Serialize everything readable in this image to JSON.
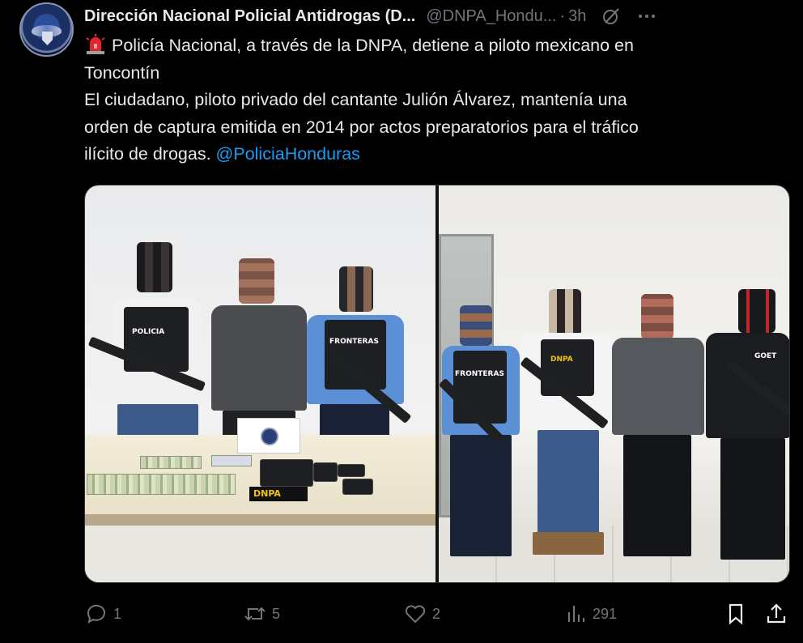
{
  "post": {
    "author_name": "Dirección Nacional Policial Antidrogas (D...",
    "handle": "@DNPA_Hondu...",
    "separator": "·",
    "time": "3h",
    "text": {
      "line1": "Policía Nacional, a través de la DNPA, detiene a piloto mexicano en",
      "line2": "Toncontín",
      "line3": "El ciudadano, piloto privado del cantante Julión Álvarez, mantenía una",
      "line4": "orden de captura emitida en 2014 por actos preparatorios para el tráfico",
      "line5_prefix": "ilícito de drogas. ",
      "mention": "@PoliciaHonduras"
    },
    "icons": {
      "leading": "rotating-light-icon",
      "grok": "grok-icon",
      "more": "more-icon"
    }
  },
  "media": {
    "left_photo": {
      "vest_label_1": "POLICIA",
      "vest_label_2": "FRONTERAS",
      "dnpa_card": "DNPA"
    },
    "right_photo": {
      "vest_label_1": "FRONTERAS",
      "vest_label_2": "DNPA",
      "vest_label_3": "GOET"
    }
  },
  "actions": {
    "reply_count": "1",
    "repost_count": "5",
    "like_count": "2",
    "view_count": "291"
  },
  "colors": {
    "background": "#000000",
    "text": "#e7e9ea",
    "muted": "#71767b",
    "accent": "#1d9bf0"
  }
}
